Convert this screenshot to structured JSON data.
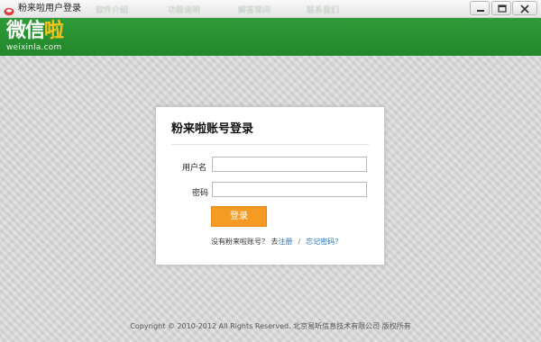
{
  "window": {
    "title": "粉来啦用户登录"
  },
  "header": {
    "tabs": [
      "软件介绍",
      "功能说明",
      "解答常问",
      "联系我们"
    ],
    "logo_main": "微信",
    "logo_accent": "啦",
    "logo_sub": "weixinla.com"
  },
  "login": {
    "title": "粉来啦账号登录",
    "username_label": "用户名",
    "username_value": "",
    "password_label": "密码",
    "password_value": "",
    "submit_label": "登录",
    "no_account_text": "没有粉来啦账号？ 去",
    "register_link": "注册",
    "separator": "/",
    "forgot_link": "忘记密码？"
  },
  "footer": {
    "copyright": "Copyright © 2010-2012 All Rights Reserved. 北京易听信息技术有限公司 版权所有"
  },
  "colors": {
    "header_green": "#2a9233",
    "logo_yellow": "#f5c21b",
    "button_orange": "#f59a22",
    "link_blue": "#1a73c9"
  }
}
